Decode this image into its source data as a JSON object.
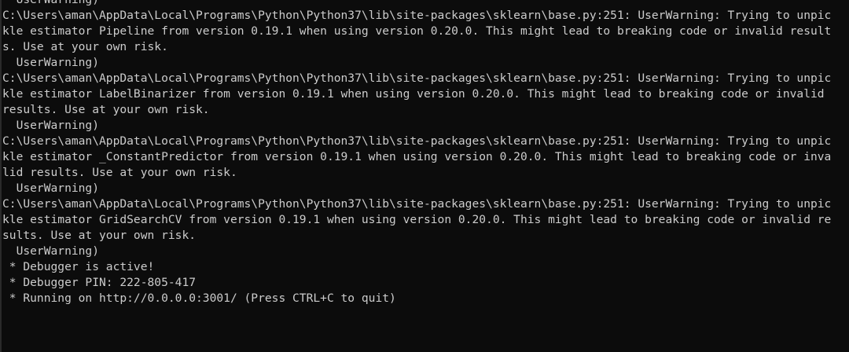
{
  "terminal": {
    "lines": [
      "  UserWarning)",
      "C:\\Users\\aman\\AppData\\Local\\Programs\\Python\\Python37\\lib\\site-packages\\sklearn\\base.py:251: UserWarning: Trying to unpic",
      "kle estimator Pipeline from version 0.19.1 when using version 0.20.0. This might lead to breaking code or invalid result",
      "s. Use at your own risk.",
      "  UserWarning)",
      "C:\\Users\\aman\\AppData\\Local\\Programs\\Python\\Python37\\lib\\site-packages\\sklearn\\base.py:251: UserWarning: Trying to unpic",
      "kle estimator LabelBinarizer from version 0.19.1 when using version 0.20.0. This might lead to breaking code or invalid",
      "results. Use at your own risk.",
      "  UserWarning)",
      "C:\\Users\\aman\\AppData\\Local\\Programs\\Python\\Python37\\lib\\site-packages\\sklearn\\base.py:251: UserWarning: Trying to unpic",
      "kle estimator _ConstantPredictor from version 0.19.1 when using version 0.20.0. This might lead to breaking code or inva",
      "lid results. Use at your own risk.",
      "  UserWarning)",
      "C:\\Users\\aman\\AppData\\Local\\Programs\\Python\\Python37\\lib\\site-packages\\sklearn\\base.py:251: UserWarning: Trying to unpic",
      "kle estimator GridSearchCV from version 0.19.1 when using version 0.20.0. This might lead to breaking code or invalid re",
      "sults. Use at your own risk.",
      "  UserWarning)",
      " * Debugger is active!",
      " * Debugger PIN: 222-805-417",
      " * Running on http://0.0.0.0:3001/ (Press CTRL+C to quit)"
    ]
  }
}
